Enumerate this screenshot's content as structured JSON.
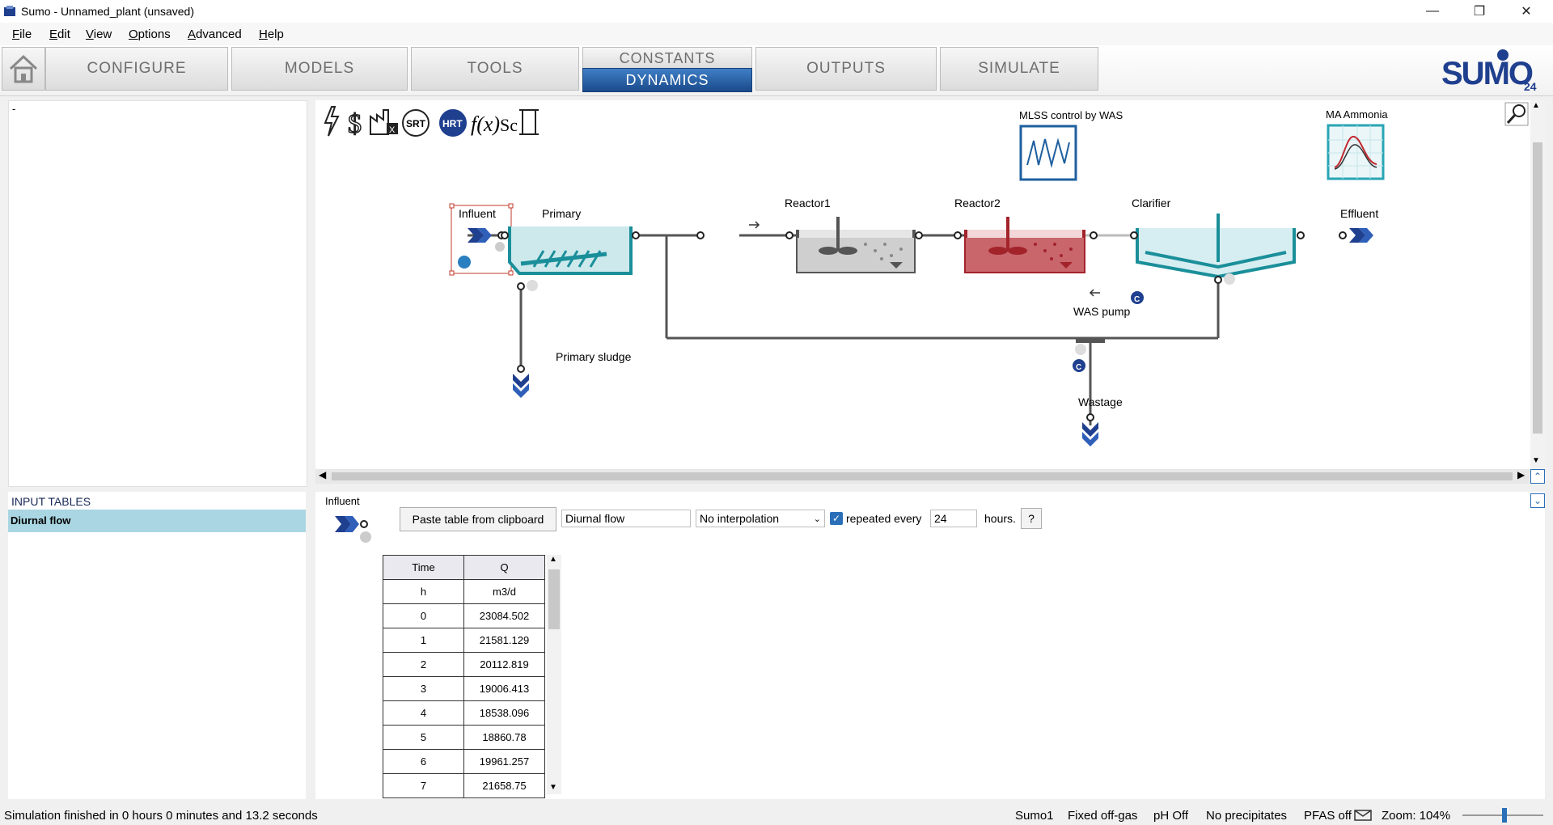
{
  "window": {
    "title": "Sumo - Unnamed_plant (unsaved)"
  },
  "menu": [
    "File",
    "Edit",
    "View",
    "Options",
    "Advanced",
    "Help"
  ],
  "tabs": {
    "configure": "CONFIGURE",
    "models": "MODELS",
    "tools": "TOOLS",
    "constants": "CONSTANTS",
    "dynamics": "DYNAMICS",
    "outputs": "OUTPUTS",
    "simulate": "SIMULATE"
  },
  "logo": {
    "text": "SUMO",
    "version": "24"
  },
  "left_panel": {
    "placeholder": "-"
  },
  "toolbar_icons": [
    "lightning-icon",
    "dollar-icon",
    "plant-excel-icon",
    "srt-icon",
    "hrt-icon",
    "function-icon",
    "formula-icon",
    "scroll-icon"
  ],
  "toolbar_text": {
    "srt": "SRT",
    "hrt": "HRT",
    "fx": "f(x)",
    "sc": "Sc"
  },
  "widgets": {
    "mlss": "MLSS control by WAS",
    "ma": "MA Ammonia"
  },
  "nodes": {
    "influent": "Influent",
    "primary": "Primary",
    "reactor1": "Reactor1",
    "reactor2": "Reactor2",
    "clarifier": "Clarifier",
    "effluent": "Effluent",
    "primary_sludge": "Primary sludge",
    "was_pump": "WAS pump",
    "wastage": "Wastage",
    "controller": "C"
  },
  "input_tables": {
    "header": "INPUT TABLES",
    "items": [
      "Diurnal flow"
    ]
  },
  "editor": {
    "object": "Influent",
    "paste_button": "Paste table from clipboard",
    "table_name": "Diurnal flow",
    "interpolation": "No interpolation",
    "repeat_checked": true,
    "repeat_label": "repeated every",
    "repeat_value": "24",
    "repeat_unit": "hours.",
    "help": "?"
  },
  "table": {
    "headers": [
      "Time",
      "Q"
    ],
    "units": [
      "h",
      "m3/d"
    ],
    "rows": [
      [
        "0",
        "23084.502"
      ],
      [
        "1",
        "21581.129"
      ],
      [
        "2",
        "20112.819"
      ],
      [
        "3",
        "19006.413"
      ],
      [
        "4",
        "18538.096"
      ],
      [
        "5",
        "18860.78"
      ],
      [
        "6",
        "19961.257"
      ],
      [
        "7",
        "21658.75"
      ]
    ]
  },
  "status": {
    "message": "Simulation finished in 0 hours 0 minutes and 13.2 seconds",
    "model": "Sumo1",
    "offgas": "Fixed off-gas",
    "ph": "pH Off",
    "precip": "No precipitates",
    "pfas": "PFAS off",
    "zoom": "Zoom: 104%",
    "zoom_level_fraction": 0.52
  },
  "colors": {
    "teal": "#1a8f9a",
    "reactor_red": "#a3232b",
    "reactor_gray": "#555555",
    "navy": "#1f3f8f",
    "active_tab": "#2a5fa8"
  }
}
